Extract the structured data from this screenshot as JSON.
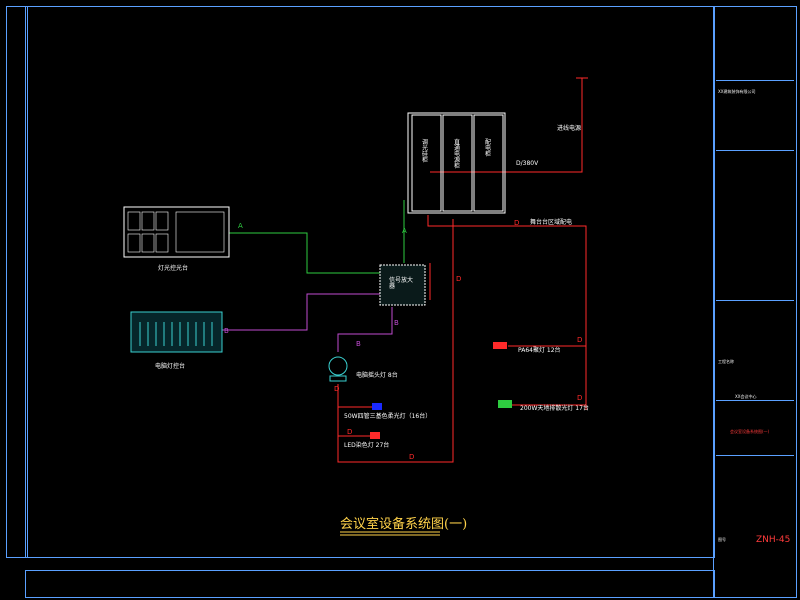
{
  "drawing": {
    "title": "会议室设备系统图(一)",
    "drawing_no": "ZNH-45"
  },
  "colors": {
    "background": "#000000",
    "frame": "#5aa0ff",
    "wire_a": "#2ecc40",
    "wire_b": "#c04bd0",
    "wire_d": "#ff2a2a",
    "text": "#ffffff",
    "title": "#ffd24a"
  },
  "equipment": {
    "lighting_console": "灯光控光台",
    "computer_console": "电脑灯控台",
    "cabinet_1": "调光硅柜",
    "cabinet_2": "直通电源柜",
    "cabinet_3": "配电柜",
    "amplifier": "信号放大器",
    "moving_head": "电脑摇头灯 8台",
    "par_light": "50W四管三基色柔光灯（16台）",
    "led_dye": "LED染色灯 27台",
    "pa_light": "PA64聚灯 12台",
    "flood_light": "200W天地排散光灯 17台",
    "power_line": "进线电源",
    "channel_label": "D/380V",
    "red_zone": "舞台台区域配电"
  },
  "wire_labels": {
    "a": "A",
    "b": "B",
    "d": "D"
  },
  "title_block": {
    "rows": [
      "XX建筑装饰有限公司",
      "工程名称",
      "XX会议中心",
      "会议室设备系统图(一)",
      "图号"
    ]
  }
}
